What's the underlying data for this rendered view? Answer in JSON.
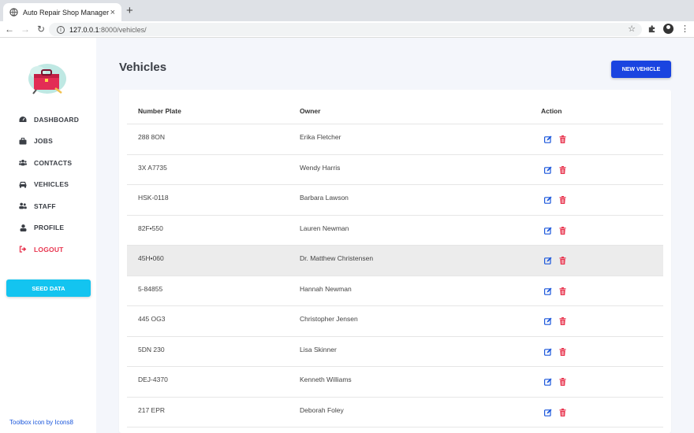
{
  "browser": {
    "tab_title": "Auto Repair Shop Manager",
    "tab_close": "×",
    "new_tab": "+",
    "url_host": "127.0.0.1",
    "url_path": ":8000/vehicles/"
  },
  "sidebar": {
    "items": [
      {
        "label": "DASHBOARD",
        "icon": "dashboard-icon"
      },
      {
        "label": "JOBS",
        "icon": "briefcase-icon"
      },
      {
        "label": "CONTACTS",
        "icon": "users-icon"
      },
      {
        "label": "VEHICLES",
        "icon": "car-icon"
      },
      {
        "label": "STAFF",
        "icon": "user-friends-icon"
      },
      {
        "label": "PROFILE",
        "icon": "user-icon"
      },
      {
        "label": "LOGOUT",
        "icon": "sign-out-icon"
      }
    ],
    "seed_button": "SEED DATA",
    "credit": "Toolbox icon by Icons8"
  },
  "main": {
    "title": "Vehicles",
    "new_button": "NEW VEHICLE",
    "columns": [
      "Number Plate",
      "Owner",
      "Action"
    ],
    "rows": [
      {
        "plate": "288 8ON",
        "owner": "Erika Fletcher"
      },
      {
        "plate": "3X A7735",
        "owner": "Wendy Harris"
      },
      {
        "plate": "HSK-0118",
        "owner": "Barbara Lawson"
      },
      {
        "plate": "82F•550",
        "owner": "Lauren Newman"
      },
      {
        "plate": "45H•060",
        "owner": "Dr. Matthew Christensen"
      },
      {
        "plate": "5-84855",
        "owner": "Hannah Newman"
      },
      {
        "plate": "445 OG3",
        "owner": "Christopher Jensen"
      },
      {
        "plate": "5DN 230",
        "owner": "Lisa Skinner"
      },
      {
        "plate": "DEJ-4370",
        "owner": "Kenneth Williams"
      },
      {
        "plate": "217 EPR",
        "owner": "Deborah Foley"
      }
    ]
  },
  "colors": {
    "accent_blue": "#1a44e0",
    "seed_cyan": "#13c4f0",
    "delete_red": "#e8344e",
    "edit_blue": "#1a56db"
  }
}
